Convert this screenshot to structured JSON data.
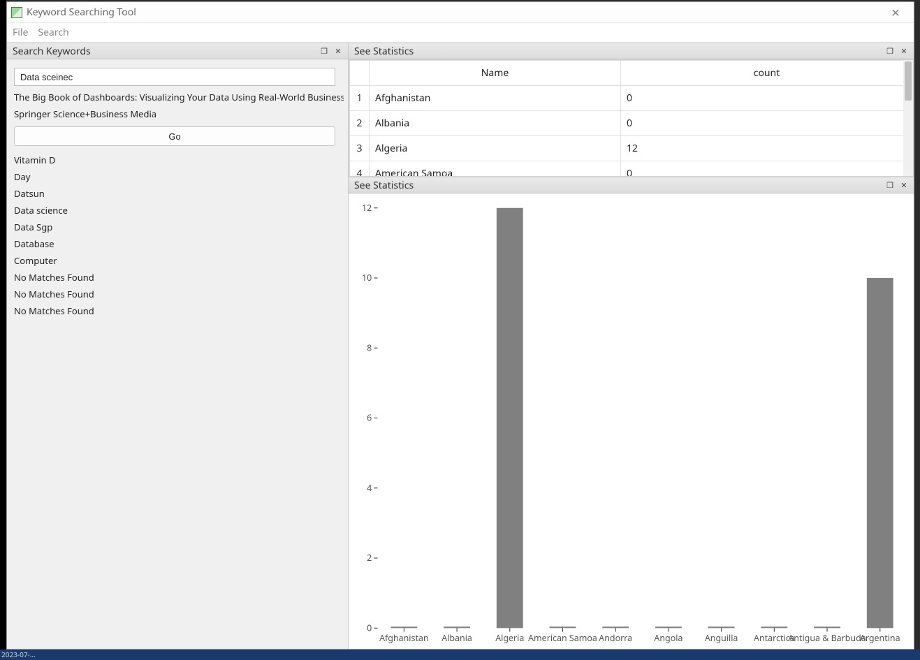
{
  "window": {
    "title": "Keyword Searching Tool",
    "close_glyph": "✕"
  },
  "menu": {
    "file": "File",
    "search": "Search"
  },
  "left_panel": {
    "title": "Search Keywords",
    "search_value": "Data sceinec",
    "line1": "The Big Book of Dashboards: Visualizing Your Data Using Real-World Business Scen",
    "line2": "Springer Science+Business Media",
    "go_label": "Go",
    "results": [
      "Vitamin D",
      "Day",
      "Datsun",
      "Data science",
      "Data Sgp",
      "Database",
      "Computer",
      "No Matches Found",
      "No Matches Found",
      "No Matches Found"
    ]
  },
  "table_panel": {
    "title": "See Statistics",
    "columns": {
      "c1": "Name",
      "c2": "count"
    },
    "rows": [
      {
        "idx": "1",
        "name": "Afghanistan",
        "count": "0"
      },
      {
        "idx": "2",
        "name": "Albania",
        "count": "0"
      },
      {
        "idx": "3",
        "name": "Algeria",
        "count": "12"
      },
      {
        "idx": "4",
        "name": "American Samoa",
        "count": "0"
      }
    ]
  },
  "chart_panel": {
    "title": "See Statistics"
  },
  "chart_data": {
    "type": "bar",
    "categories": [
      "Afghanistan",
      "Albania",
      "Algeria",
      "American Samoa",
      "Andorra",
      "Angola",
      "Anguilla",
      "Antarctica",
      "Antigua & Barbuda",
      "Argentina"
    ],
    "values": [
      0,
      0,
      12,
      0,
      0,
      0,
      0,
      0,
      0,
      10
    ],
    "yticks": [
      0,
      2,
      4,
      6,
      8,
      10,
      12
    ],
    "ylim": [
      0,
      12
    ],
    "bar_color": "#808080"
  },
  "dock_buttons": {
    "float_glyph": "❐",
    "close_glyph": "✕"
  },
  "footer": {
    "text": "2023-07-…"
  }
}
